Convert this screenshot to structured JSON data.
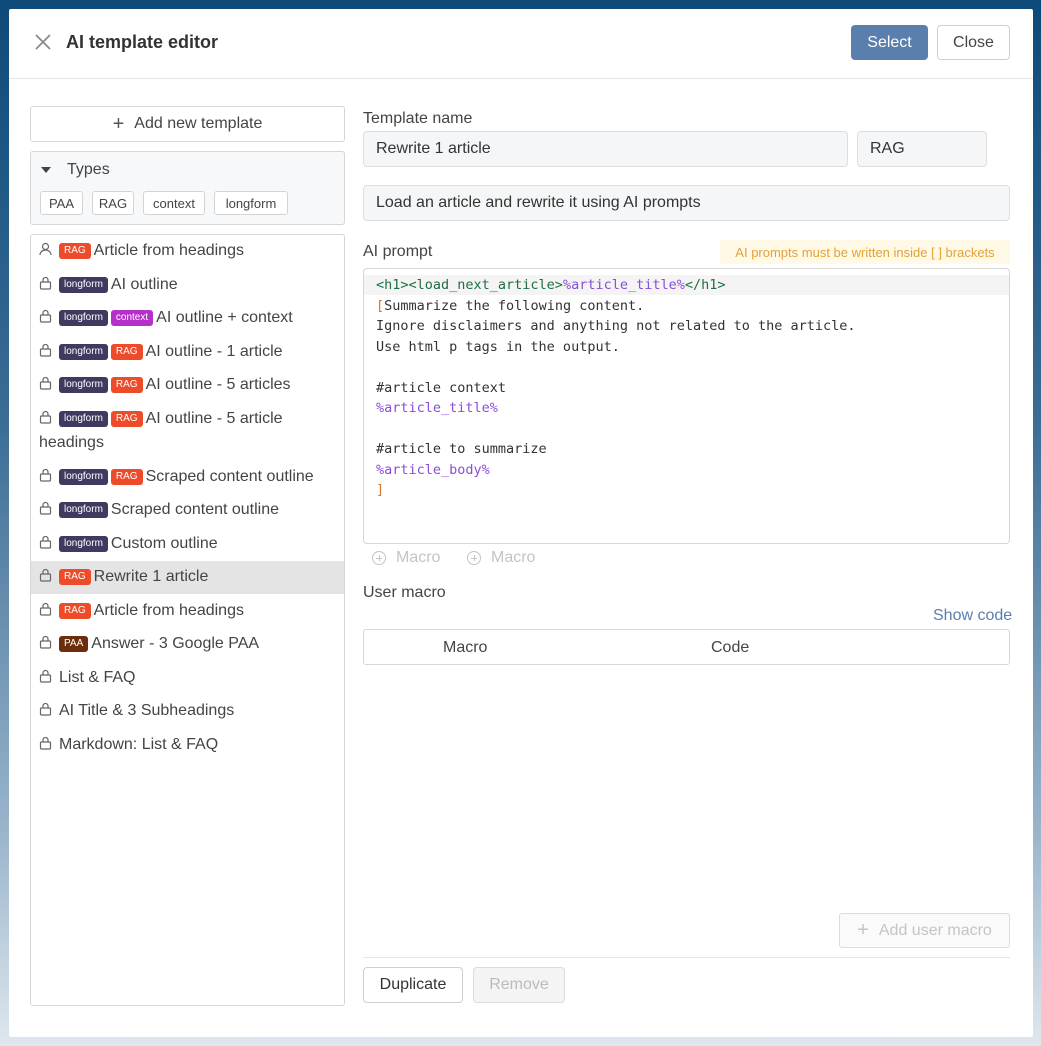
{
  "header": {
    "title": "AI template editor",
    "select_label": "Select",
    "close_label": "Close"
  },
  "sidebar": {
    "add_label": "Add new template",
    "types_label": "Types",
    "types": [
      "PAA",
      "RAG",
      "context",
      "longform"
    ],
    "items": [
      {
        "icon": "user-icon",
        "tags": [
          "RAG"
        ],
        "label": "Article from headings",
        "active": false
      },
      {
        "icon": "lock-icon",
        "tags": [
          "longform"
        ],
        "label": "AI outline",
        "active": false
      },
      {
        "icon": "lock-icon",
        "tags": [
          "longform",
          "context"
        ],
        "label": "AI outline + context",
        "active": false
      },
      {
        "icon": "lock-icon",
        "tags": [
          "longform",
          "RAG"
        ],
        "label": "AI outline - 1 article",
        "active": false
      },
      {
        "icon": "lock-icon",
        "tags": [
          "longform",
          "RAG"
        ],
        "label": "AI outline - 5 articles",
        "active": false
      },
      {
        "icon": "lock-icon",
        "tags": [
          "longform",
          "RAG"
        ],
        "label": "AI outline - 5 article headings",
        "active": false
      },
      {
        "icon": "lock-icon",
        "tags": [
          "longform",
          "RAG"
        ],
        "label": "Scraped content outline",
        "active": false
      },
      {
        "icon": "lock-icon",
        "tags": [
          "longform"
        ],
        "label": "Scraped content outline",
        "active": false
      },
      {
        "icon": "lock-icon",
        "tags": [
          "longform"
        ],
        "label": "Custom outline",
        "active": false
      },
      {
        "icon": "lock-icon",
        "tags": [
          "RAG"
        ],
        "label": "Rewrite 1 article",
        "active": true
      },
      {
        "icon": "lock-icon",
        "tags": [
          "RAG"
        ],
        "label": "Article from headings",
        "active": false
      },
      {
        "icon": "lock-icon",
        "tags": [
          "PAA"
        ],
        "label": "Answer - 3 Google PAA",
        "active": false
      },
      {
        "icon": "lock-icon",
        "tags": [],
        "label": "List & FAQ",
        "active": false
      },
      {
        "icon": "lock-icon",
        "tags": [],
        "label": "AI Title & 3 Subheadings",
        "active": false
      },
      {
        "icon": "lock-icon",
        "tags": [],
        "label": "Markdown: List & FAQ",
        "active": false
      }
    ]
  },
  "form": {
    "name_label": "Template name",
    "name_value": "Rewrite 1 article",
    "type_value": "RAG",
    "description_value": "Load an article and rewrite it using AI prompts",
    "prompt_label": "AI prompt",
    "prompt_warning": "AI prompts must be written inside [ ] brackets",
    "prompt_lines": [
      [
        {
          "t": "<h1><load_next_article>",
          "c": "tag"
        },
        {
          "t": "%article_title%",
          "c": "var"
        },
        {
          "t": "</h1>",
          "c": "tag"
        }
      ],
      [
        {
          "t": "[",
          "c": "br"
        },
        {
          "t": "Summarize the following content.",
          "c": ""
        }
      ],
      [
        {
          "t": "Ignore disclaimers and anything not related to the article.",
          "c": ""
        }
      ],
      [
        {
          "t": "Use html p tags in the output.",
          "c": ""
        }
      ],
      [
        {
          "t": "",
          "c": ""
        }
      ],
      [
        {
          "t": "#article context",
          "c": ""
        }
      ],
      [
        {
          "t": "%article_title%",
          "c": "var"
        }
      ],
      [
        {
          "t": "",
          "c": ""
        }
      ],
      [
        {
          "t": "#article to summarize",
          "c": ""
        }
      ],
      [
        {
          "t": "%article_body%",
          "c": "var"
        }
      ],
      [
        {
          "t": "]",
          "c": "br"
        }
      ]
    ],
    "macro_button_1": "Macro",
    "macro_button_2": "Macro",
    "user_macro_label": "User macro",
    "show_code_label": "Show code",
    "table_headers": [
      "Macro",
      "Code"
    ],
    "add_user_macro_label": "Add user macro",
    "duplicate_label": "Duplicate",
    "remove_label": "Remove"
  }
}
